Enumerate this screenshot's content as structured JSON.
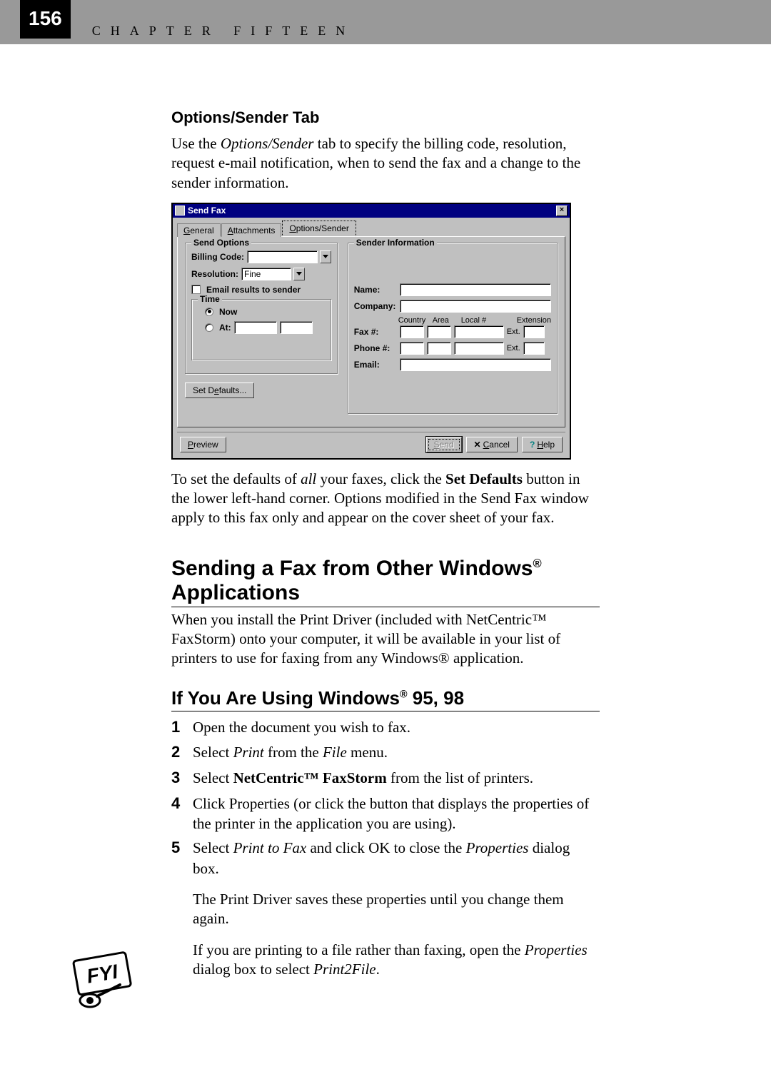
{
  "page": {
    "number": "156",
    "chapter_header": "CHAPTER FIFTEEN"
  },
  "section_heading": "Options/Sender Tab",
  "intro_para": "Use the Options/Sender tab to specify the billing code, resolution, request e-mail notification, when to send the fax and a change to the sender information.",
  "dialog": {
    "title": "Send Fax",
    "tabs": {
      "general": "General",
      "attachments": "Attachments",
      "options_sender": "Options/Sender"
    },
    "send_options": {
      "legend": "Send Options",
      "billing_code_label": "Billing Code:",
      "resolution_label": "Resolution:",
      "resolution_value": "Fine",
      "email_results_label": "Email results to sender"
    },
    "time": {
      "legend": "Time",
      "now_label": "Now",
      "at_label": "At:"
    },
    "set_defaults": "Set Defaults...",
    "sender": {
      "legend": "Sender Information",
      "name_label": "Name:",
      "company_label": "Company:",
      "cols": {
        "country": "Country",
        "area": "Area",
        "local": "Local #",
        "extension": "Extension"
      },
      "fax_label": "Fax #:",
      "phone_label": "Phone #:",
      "ext_label": "Ext.",
      "email_label": "Email:"
    },
    "buttons": {
      "preview": "Preview",
      "send": "Send",
      "cancel": "Cancel",
      "help": "Help"
    }
  },
  "after_dialog_para": "To set the defaults of all your faxes, click the Set Defaults button in the lower left-hand corner. Options modified in the Send Fax window apply to this fax only and appear on the cover sheet of your fax.",
  "heading2": {
    "pre": "Sending a Fax from Other Windows",
    "post": " Applications"
  },
  "para2": "When you install the Print Driver (included with NetCentric™ FaxStorm) onto your computer, it will be available in your list of printers to use for faxing from any Windows® application.",
  "heading3": {
    "pre": "If You Are Using Windows",
    "post": " 95, 98"
  },
  "steps": {
    "s1": "Open the document you wish to fax.",
    "s2a": "Select ",
    "s2b": "Print",
    "s2c": " from the ",
    "s2d": "File",
    "s2e": " menu.",
    "s3a": "Select ",
    "s3b": "NetCentric™ FaxStorm",
    "s3c": " from the list of printers.",
    "s4": "Click Properties (or click the button that displays the properties of the printer in the application  you are using).",
    "s5a": "Select ",
    "s5b": "Print to Fax",
    "s5c": " and click OK to close the ",
    "s5d": "Properties",
    "s5e": " dialog box.",
    "note1": "The Print Driver saves these properties until you change them again.",
    "note2a": "If you are printing to a file rather than faxing, open the ",
    "note2b": "Properties",
    "note2c": " dialog box to select ",
    "note2d": "Print2File",
    "note2e": "."
  }
}
